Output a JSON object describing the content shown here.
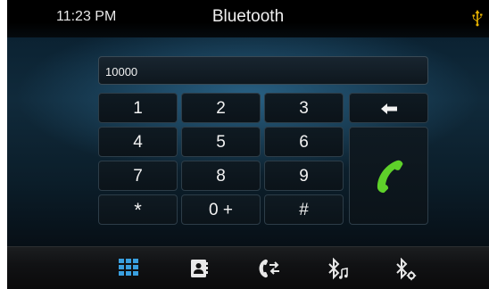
{
  "status_bar": {
    "time": "11:23 PM",
    "title": "Bluetooth",
    "icons": [
      "usb-icon"
    ]
  },
  "dialer": {
    "number": "10000",
    "keys": {
      "k1": "1",
      "k2": "2",
      "k3": "3",
      "k4": "4",
      "k5": "5",
      "k6": "6",
      "k7": "7",
      "k8": "8",
      "k9": "9",
      "kstar": "*",
      "k0": "0 +",
      "khash": "#"
    },
    "backspace_icon": "backspace-arrow-icon",
    "call_icon": "phone-call-icon"
  },
  "bottom_nav": {
    "items": [
      "dialpad-icon",
      "contacts-icon",
      "call-log-icon",
      "bluetooth-music-icon",
      "bluetooth-settings-icon"
    ],
    "active": "dialpad-icon"
  },
  "colors": {
    "accent_active": "#3aa0e0",
    "call_green": "#5ed12a",
    "usb_yellow": "#e8b400"
  }
}
